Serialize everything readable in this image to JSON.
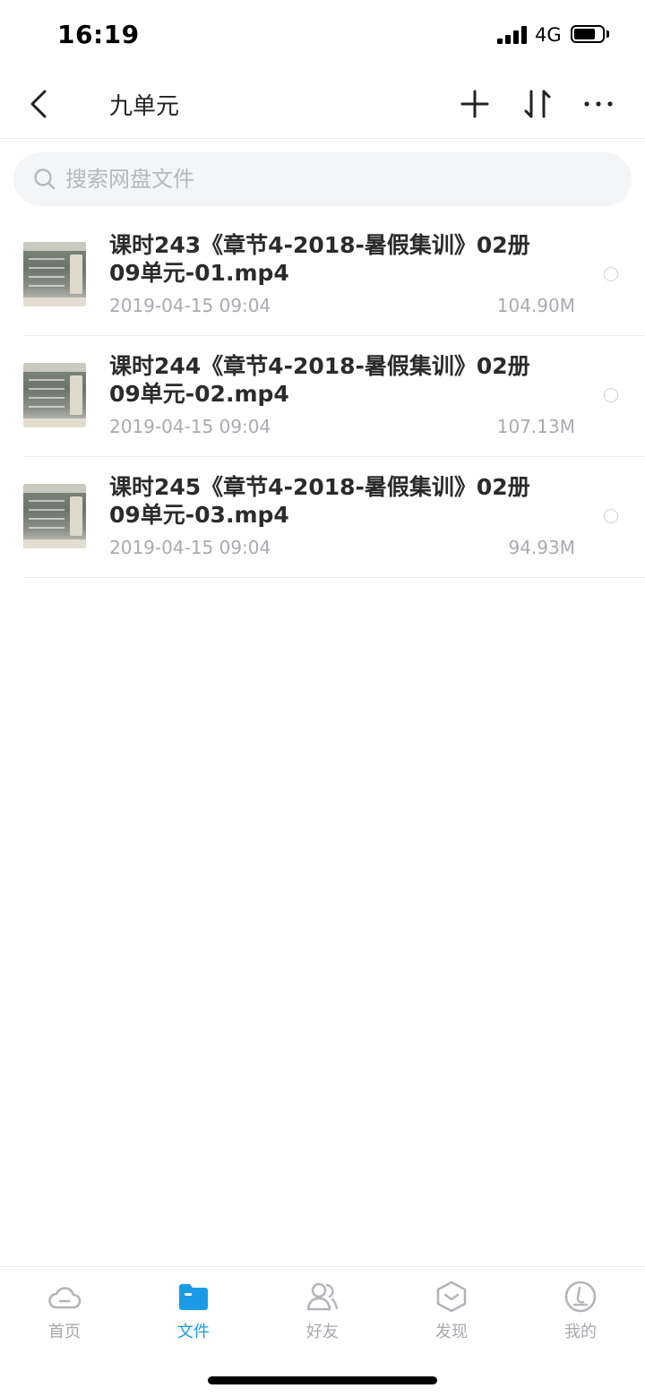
{
  "status_bar": {
    "time": "16:19",
    "network": "4G"
  },
  "nav": {
    "title": "九单元",
    "icons": [
      "back-icon",
      "plus-icon",
      "sort-icon",
      "more-icon"
    ]
  },
  "search": {
    "placeholder": "搜索网盘文件",
    "value": ""
  },
  "files": [
    {
      "name": "课时243《章节4-2018-暑假集训》02册09单元-01.mp4",
      "date": "2019-04-15 09:04",
      "size": "104.90M"
    },
    {
      "name": "课时244《章节4-2018-暑假集训》02册09单元-02.mp4",
      "date": "2019-04-15 09:04",
      "size": "107.13M"
    },
    {
      "name": "课时245《章节4-2018-暑假集训》02册09单元-03.mp4",
      "date": "2019-04-15 09:04",
      "size": "94.93M"
    }
  ],
  "tabs": [
    {
      "label": "首页",
      "icon": "cloud-icon",
      "active": false
    },
    {
      "label": "文件",
      "icon": "folder-icon",
      "active": true
    },
    {
      "label": "好友",
      "icon": "friends-icon",
      "active": false
    },
    {
      "label": "发现",
      "icon": "discover-icon",
      "active": false
    },
    {
      "label": "我的",
      "icon": "profile-icon",
      "active": false
    }
  ],
  "colors": {
    "accent": "#1b9be6",
    "muted_text": "#a9abb0",
    "tab_inactive": "#a7a9ae"
  }
}
